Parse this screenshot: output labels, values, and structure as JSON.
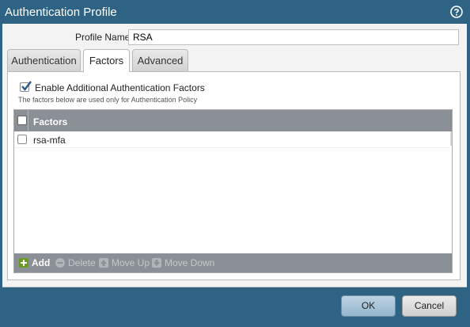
{
  "window": {
    "title": "Authentication Profile"
  },
  "profile": {
    "label": "Profile Name",
    "value": "RSA"
  },
  "tabs": [
    {
      "label": "Authentication",
      "active": false
    },
    {
      "label": "Factors",
      "active": true
    },
    {
      "label": "Advanced",
      "active": false
    }
  ],
  "factors": {
    "enable_label": "Enable Additional Authentication Factors",
    "enable_checked": true,
    "note": "The factors below are used only for Authentication Policy",
    "column_header": "Factors",
    "rows": [
      {
        "label": "rsa-mfa",
        "checked": false
      }
    ]
  },
  "toolbar": {
    "add": "Add",
    "delete": "Delete",
    "move_up": "Move Up",
    "move_down": "Move Down"
  },
  "buttons": {
    "ok": "OK",
    "cancel": "Cancel"
  },
  "colors": {
    "header": "#2e6384",
    "grid_header": "#8a9096",
    "add_icon": "#6a9a1f",
    "disabled_text": "#c4c8cc"
  }
}
